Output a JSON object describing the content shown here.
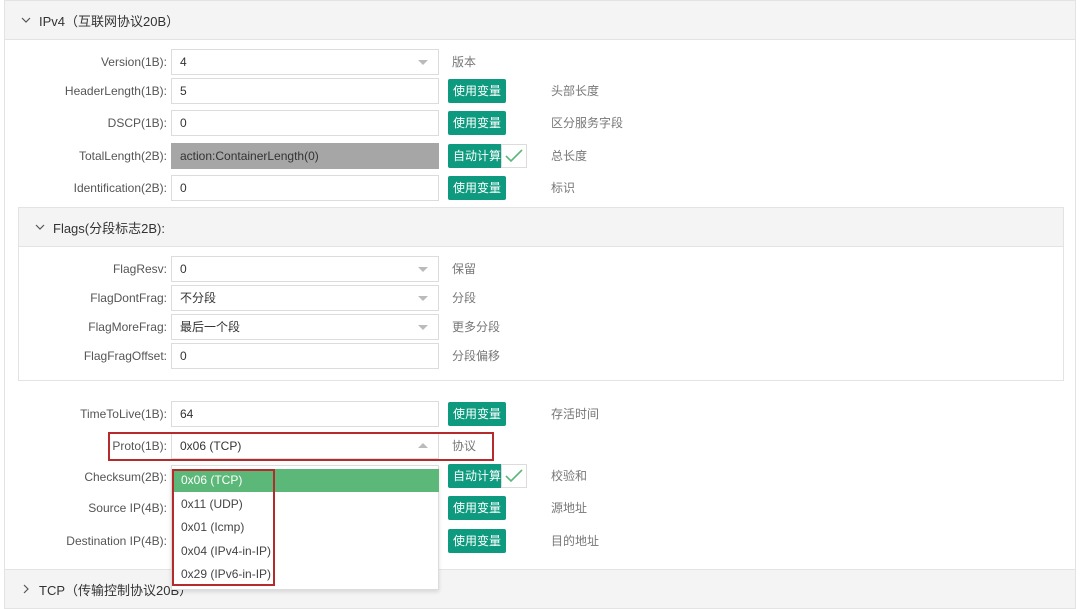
{
  "ipv4": {
    "header": "IPv4（互联网协议20B）",
    "fields": [
      {
        "label": "Version(1B):",
        "value": "4",
        "type": "select",
        "desc": "版本"
      },
      {
        "label": "HeaderLength(1B):",
        "value": "5",
        "type": "input",
        "button": "使用变量",
        "desc": "头部长度"
      },
      {
        "label": "DSCP(1B):",
        "value": "0",
        "type": "input",
        "button": "使用变量",
        "desc": "区分服务字段"
      },
      {
        "label": "TotalLength(2B):",
        "value": "action:ContainerLength(0)",
        "type": "auto",
        "button": "自动计算",
        "desc": "总长度"
      },
      {
        "label": "Identification(2B):",
        "value": "0",
        "type": "input",
        "button": "使用变量",
        "desc": "标识"
      }
    ],
    "flags": {
      "header": "Flags(分段标志2B):",
      "fields": [
        {
          "label": "FlagResv:",
          "value": "0",
          "desc": "保留"
        },
        {
          "label": "FlagDontFrag:",
          "value": "不分段",
          "desc": "分段"
        },
        {
          "label": "FlagMoreFrag:",
          "value": "最后一个段",
          "desc": "更多分段"
        },
        {
          "label": "FlagFragOffset:",
          "value": "0",
          "desc": "分段偏移"
        }
      ]
    },
    "fields2": [
      {
        "label": "TimeToLive(1B):",
        "value": "64",
        "button": "使用变量",
        "desc": "存活时间"
      },
      {
        "label": "Proto(1B):",
        "value": "0x06 (TCP)",
        "desc": "协议"
      },
      {
        "label": "Checksum(2B):",
        "button": "自动计算",
        "desc": "校验和"
      },
      {
        "label": "Source IP(4B):",
        "button": "使用变量",
        "desc": "源地址"
      },
      {
        "label": "Destination IP(4B):",
        "button": "使用变量",
        "desc": "目的地址"
      }
    ],
    "proto_options": [
      "0x06 (TCP)",
      "0x11 (UDP)",
      "0x01 (Icmp)",
      "0x04 (IPv4-in-IP)",
      "0x29 (IPv6-in-IP)"
    ]
  },
  "tcp": {
    "header": "TCP（传输控制协议20B）"
  },
  "colors": {
    "accent": "#0e9a7e",
    "selected_option": "#5bb878",
    "highlight_box": "#b52a2a"
  }
}
